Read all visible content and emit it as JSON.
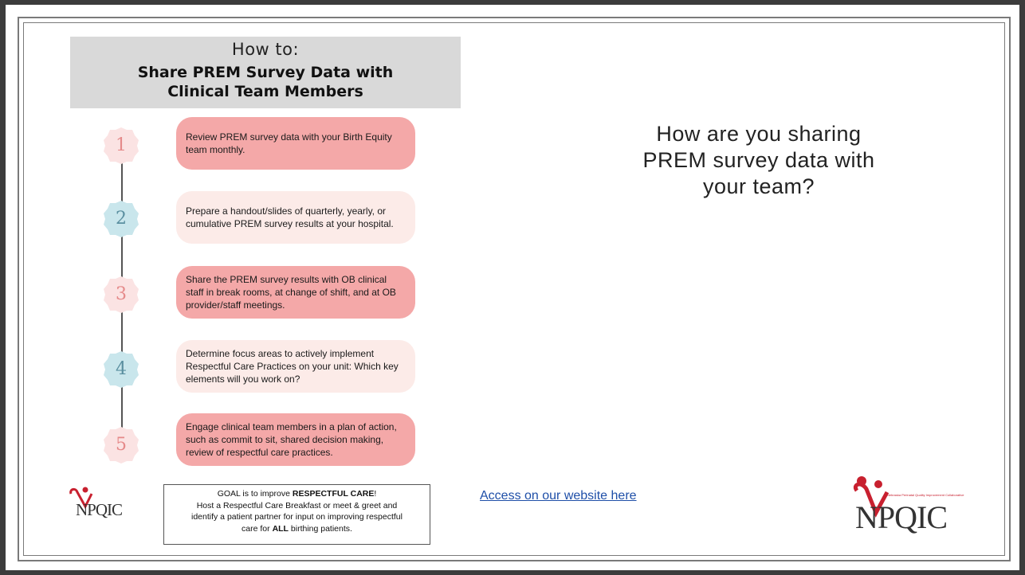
{
  "header": {
    "line1": "How to:",
    "line2": "Share PREM Survey Data with",
    "line3": "Clinical Team Members"
  },
  "steps": [
    {
      "number": "1",
      "text": "Review PREM survey data with your Birth Equity team monthly.",
      "style": "dark",
      "badge_color": "#fbe3e3",
      "number_color": "#e58a8a"
    },
    {
      "number": "2",
      "text": "Prepare a handout/slides of quarterly, yearly, or cumulative PREM survey results at your hospital.",
      "style": "light",
      "badge_color": "#c9e6ec",
      "number_color": "#5a8fa0"
    },
    {
      "number": "3",
      "text": "Share the PREM survey results with OB clinical staff in break rooms, at change of shift, and at OB provider/staff meetings.",
      "style": "dark",
      "badge_color": "#fbe3e3",
      "number_color": "#e58a8a"
    },
    {
      "number": "4",
      "text": "Determine focus areas to actively implement Respectful Care Practices on your unit: Which key elements will you work on?",
      "style": "light",
      "badge_color": "#c9e6ec",
      "number_color": "#5a8fa0"
    },
    {
      "number": "5",
      "text": "Engage clinical team members in a plan of action, such as commit to sit, shared decision making, review of respectful care practices.",
      "style": "dark",
      "badge_color": "#fbe3e3",
      "number_color": "#e58a8a"
    }
  ],
  "goal": {
    "l1_pre": "GOAL is to improve ",
    "l1_bold": "RESPECTFUL CARE",
    "l1_post": "!",
    "l2": "Host a Respectful Care Breakfast or meet & greet and",
    "l3": "identify a patient partner for input on improving respectful",
    "l4_pre": "care for ",
    "l4_bold": "ALL",
    "l4_post": " birthing patients."
  },
  "question": {
    "line1": "How are you sharing",
    "line2": "PREM survey data with",
    "line3": "your team?"
  },
  "link_text": "Access on our website here",
  "logo_small": {
    "word": "NPQIC"
  },
  "logo_large": {
    "word": "NPQIC",
    "tagline": "Nebraska Perinatal Quality Improvement Collaborative"
  },
  "colors": {
    "brand_red": "#c8202f",
    "step_dark": "#f4a8a8",
    "step_light": "#fcebe8",
    "header_bg": "#d9d9d9",
    "link": "#1f4fa8"
  }
}
